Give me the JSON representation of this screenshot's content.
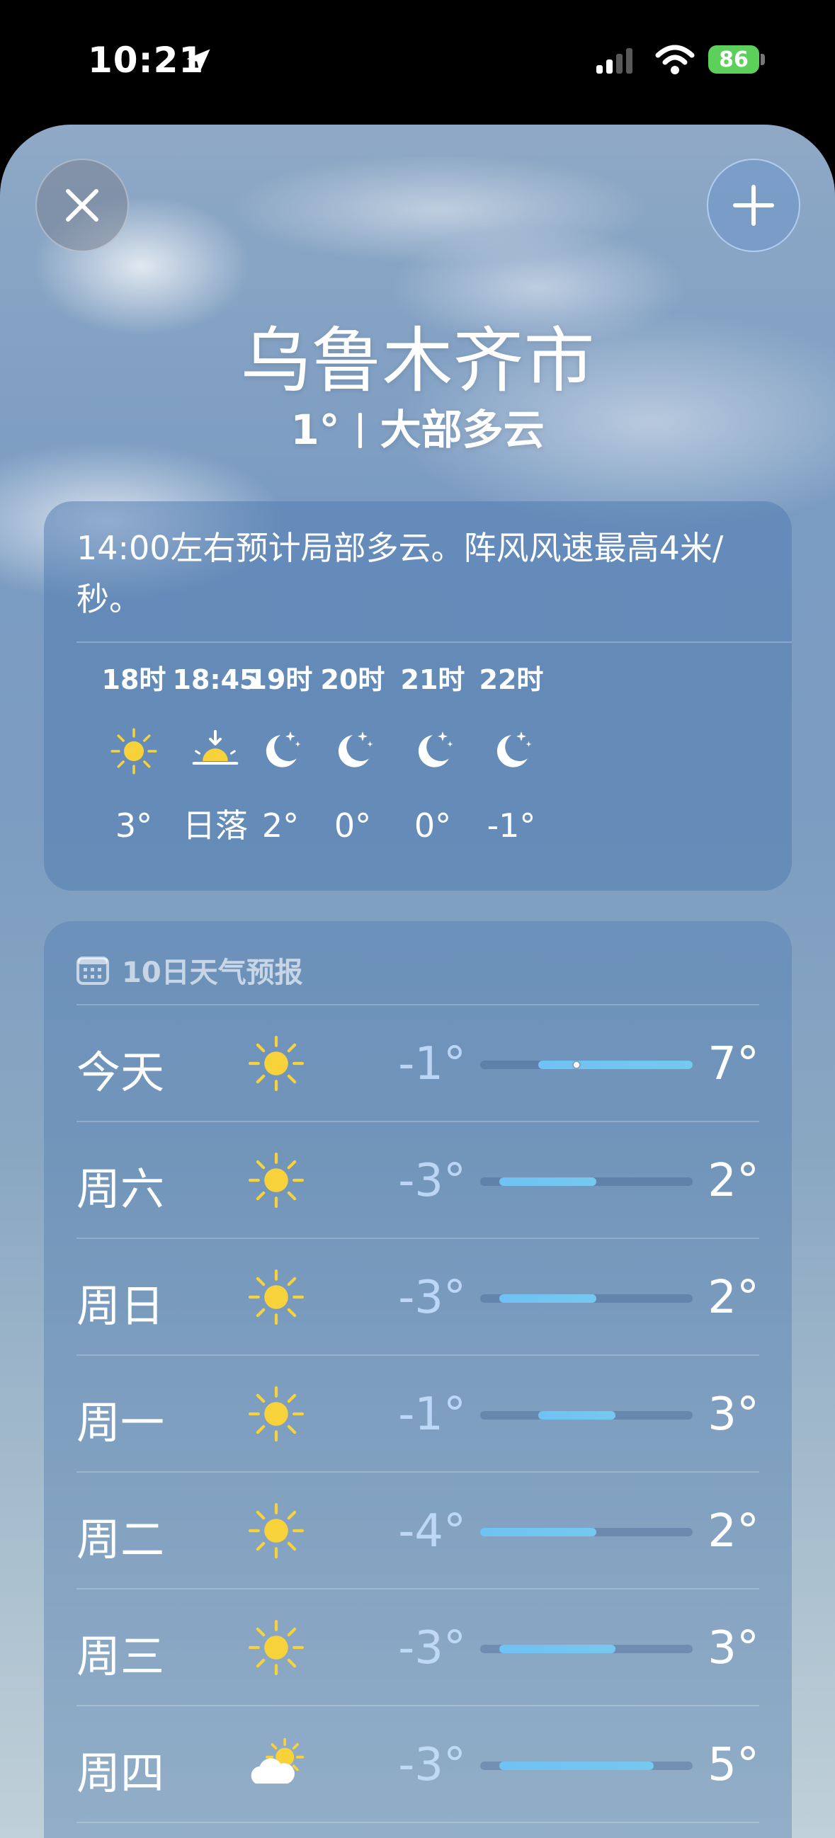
{
  "status_bar": {
    "time": "10:21",
    "battery": "86",
    "icons": [
      "location-arrow-icon",
      "cellular-signal-icon",
      "wifi-icon",
      "battery-charging-icon"
    ]
  },
  "header": {
    "city": "乌鲁木齐市",
    "current_temp": "1°",
    "condition": "大部多云"
  },
  "hourly": {
    "description": "14:00左右预计局部多云。阵风风速最高4米/秒。",
    "items": [
      {
        "time": "18时",
        "icon": "sun-icon",
        "value": "3°"
      },
      {
        "time": "18:45",
        "icon": "sunset-icon",
        "value": "日落"
      },
      {
        "time": "19时",
        "icon": "moon-stars-icon",
        "value": "2°"
      },
      {
        "time": "20时",
        "icon": "moon-stars-icon",
        "value": "0°"
      },
      {
        "time": "21时",
        "icon": "moon-stars-icon",
        "value": "0°"
      },
      {
        "time": "22时",
        "icon": "moon-stars-icon",
        "value": "-1°"
      }
    ]
  },
  "daily": {
    "title": "10日天气预报",
    "range_min": -4,
    "range_max": 7,
    "current_temp": 1,
    "days": [
      {
        "name": "今天",
        "icon": "sun-icon",
        "low": "-1°",
        "high": "7°",
        "lo": -1,
        "hi": 7,
        "current": true
      },
      {
        "name": "周六",
        "icon": "sun-icon",
        "low": "-3°",
        "high": "2°",
        "lo": -3,
        "hi": 2
      },
      {
        "name": "周日",
        "icon": "sun-icon",
        "low": "-3°",
        "high": "2°",
        "lo": -3,
        "hi": 2
      },
      {
        "name": "周一",
        "icon": "sun-icon",
        "low": "-1°",
        "high": "3°",
        "lo": -1,
        "hi": 3
      },
      {
        "name": "周二",
        "icon": "sun-icon",
        "low": "-4°",
        "high": "2°",
        "lo": -4,
        "hi": 2
      },
      {
        "name": "周三",
        "icon": "sun-icon",
        "low": "-3°",
        "high": "3°",
        "lo": -3,
        "hi": 3
      },
      {
        "name": "周四",
        "icon": "partly-cloudy-icon",
        "low": "-3°",
        "high": "5°",
        "lo": -3,
        "hi": 5
      }
    ]
  },
  "colors": {
    "accent_bar": "#6fc2f4",
    "sun": "#f7d23a",
    "battery": "#5bd05a"
  }
}
